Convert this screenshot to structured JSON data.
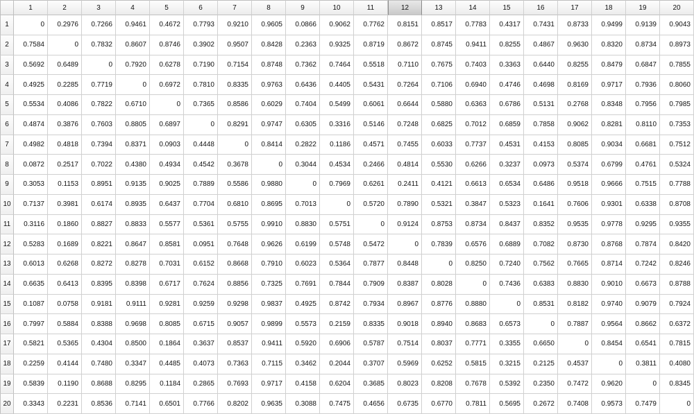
{
  "selected_column": 12,
  "column_headers": [
    "1",
    "2",
    "3",
    "4",
    "5",
    "6",
    "7",
    "8",
    "9",
    "10",
    "11",
    "12",
    "13",
    "14",
    "15",
    "16",
    "17",
    "18",
    "19",
    "20"
  ],
  "row_headers": [
    "1",
    "2",
    "3",
    "4",
    "5",
    "6",
    "7",
    "8",
    "9",
    "10",
    "11",
    "12",
    "13",
    "14",
    "15",
    "16",
    "17",
    "18",
    "19",
    "20"
  ],
  "chart_data": {
    "type": "table",
    "title": "",
    "columns": [
      "1",
      "2",
      "3",
      "4",
      "5",
      "6",
      "7",
      "8",
      "9",
      "10",
      "11",
      "12",
      "13",
      "14",
      "15",
      "16",
      "17",
      "18",
      "19",
      "20"
    ],
    "rows": [
      [
        "0",
        "0.2976",
        "0.7266",
        "0.9461",
        "0.4672",
        "0.7793",
        "0.9210",
        "0.9605",
        "0.0866",
        "0.9062",
        "0.7762",
        "0.8151",
        "0.8517",
        "0.7783",
        "0.4317",
        "0.7431",
        "0.8733",
        "0.9499",
        "0.9139",
        "0.9043"
      ],
      [
        "0.7584",
        "0",
        "0.7832",
        "0.8607",
        "0.8746",
        "0.3902",
        "0.9507",
        "0.8428",
        "0.2363",
        "0.9325",
        "0.8719",
        "0.8672",
        "0.8745",
        "0.9411",
        "0.8255",
        "0.4867",
        "0.9630",
        "0.8320",
        "0.8734",
        "0.8973"
      ],
      [
        "0.5692",
        "0.6489",
        "0",
        "0.7920",
        "0.6278",
        "0.7190",
        "0.7154",
        "0.8748",
        "0.7362",
        "0.7464",
        "0.5518",
        "0.7110",
        "0.7675",
        "0.7403",
        "0.3363",
        "0.6440",
        "0.8255",
        "0.8479",
        "0.6847",
        "0.7855"
      ],
      [
        "0.4925",
        "0.2285",
        "0.7719",
        "0",
        "0.6972",
        "0.7810",
        "0.8335",
        "0.9763",
        "0.6436",
        "0.4405",
        "0.5431",
        "0.7264",
        "0.7106",
        "0.6940",
        "0.4746",
        "0.4698",
        "0.8169",
        "0.9717",
        "0.7936",
        "0.8060"
      ],
      [
        "0.5534",
        "0.4086",
        "0.7822",
        "0.6710",
        "0",
        "0.7365",
        "0.8586",
        "0.6029",
        "0.7404",
        "0.5499",
        "0.6061",
        "0.6644",
        "0.5880",
        "0.6363",
        "0.6786",
        "0.5131",
        "0.2768",
        "0.8348",
        "0.7956",
        "0.7985"
      ],
      [
        "0.4874",
        "0.3876",
        "0.7603",
        "0.8805",
        "0.6897",
        "0",
        "0.8291",
        "0.9747",
        "0.6305",
        "0.3316",
        "0.5146",
        "0.7248",
        "0.6825",
        "0.7012",
        "0.6859",
        "0.7858",
        "0.9062",
        "0.8281",
        "0.8110",
        "0.7353"
      ],
      [
        "0.4982",
        "0.4818",
        "0.7394",
        "0.8371",
        "0.0903",
        "0.4448",
        "0",
        "0.8414",
        "0.2822",
        "0.1186",
        "0.4571",
        "0.7455",
        "0.6033",
        "0.7737",
        "0.4531",
        "0.4153",
        "0.8085",
        "0.9034",
        "0.6681",
        "0.7512"
      ],
      [
        "0.0872",
        "0.2517",
        "0.7022",
        "0.4380",
        "0.4934",
        "0.4542",
        "0.3678",
        "0",
        "0.3044",
        "0.4534",
        "0.2466",
        "0.4814",
        "0.5530",
        "0.6266",
        "0.3237",
        "0.0973",
        "0.5374",
        "0.6799",
        "0.4761",
        "0.5324"
      ],
      [
        "0.3053",
        "0.1153",
        "0.8951",
        "0.9135",
        "0.9025",
        "0.7889",
        "0.5586",
        "0.9880",
        "0",
        "0.7969",
        "0.6261",
        "0.2411",
        "0.4121",
        "0.6613",
        "0.6534",
        "0.6486",
        "0.9518",
        "0.9666",
        "0.7515",
        "0.7788"
      ],
      [
        "0.7137",
        "0.3981",
        "0.6174",
        "0.8935",
        "0.6437",
        "0.7704",
        "0.6810",
        "0.8695",
        "0.7013",
        "0",
        "0.5720",
        "0.7890",
        "0.5321",
        "0.3847",
        "0.5323",
        "0.1641",
        "0.7606",
        "0.9301",
        "0.6338",
        "0.8708"
      ],
      [
        "0.3116",
        "0.1860",
        "0.8827",
        "0.8833",
        "0.5577",
        "0.5361",
        "0.5755",
        "0.9910",
        "0.8830",
        "0.5751",
        "0",
        "0.9124",
        "0.8753",
        "0.8734",
        "0.8437",
        "0.8352",
        "0.9535",
        "0.9778",
        "0.9295",
        "0.9355"
      ],
      [
        "0.5283",
        "0.1689",
        "0.8221",
        "0.8647",
        "0.8581",
        "0.0951",
        "0.7648",
        "0.9626",
        "0.6199",
        "0.5748",
        "0.5472",
        "0",
        "0.7839",
        "0.6576",
        "0.6889",
        "0.7082",
        "0.8730",
        "0.8768",
        "0.7874",
        "0.8420"
      ],
      [
        "0.6013",
        "0.6268",
        "0.8272",
        "0.8278",
        "0.7031",
        "0.6152",
        "0.8668",
        "0.7910",
        "0.6023",
        "0.5364",
        "0.7877",
        "0.8448",
        "0",
        "0.8250",
        "0.7240",
        "0.7562",
        "0.7665",
        "0.8714",
        "0.7242",
        "0.8246"
      ],
      [
        "0.6635",
        "0.6413",
        "0.8395",
        "0.8398",
        "0.6717",
        "0.7624",
        "0.8856",
        "0.7325",
        "0.7691",
        "0.7844",
        "0.7909",
        "0.8387",
        "0.8028",
        "0",
        "0.7436",
        "0.6383",
        "0.8830",
        "0.9010",
        "0.6673",
        "0.8788"
      ],
      [
        "0.1087",
        "0.0758",
        "0.9181",
        "0.9111",
        "0.9281",
        "0.9259",
        "0.9298",
        "0.9837",
        "0.4925",
        "0.8742",
        "0.7934",
        "0.8967",
        "0.8776",
        "0.8880",
        "0",
        "0.8531",
        "0.8182",
        "0.9740",
        "0.9079",
        "0.7924"
      ],
      [
        "0.7997",
        "0.5884",
        "0.8388",
        "0.9698",
        "0.8085",
        "0.6715",
        "0.9057",
        "0.9899",
        "0.5573",
        "0.2159",
        "0.8335",
        "0.9018",
        "0.8940",
        "0.8683",
        "0.6573",
        "0",
        "0.7887",
        "0.9564",
        "0.8662",
        "0.6372"
      ],
      [
        "0.5821",
        "0.5365",
        "0.4304",
        "0.8500",
        "0.1864",
        "0.3637",
        "0.8537",
        "0.9411",
        "0.5920",
        "0.6906",
        "0.5787",
        "0.7514",
        "0.8037",
        "0.7771",
        "0.3355",
        "0.6650",
        "0",
        "0.8454",
        "0.6541",
        "0.7815"
      ],
      [
        "0.2259",
        "0.4144",
        "0.7480",
        "0.3347",
        "0.4485",
        "0.4073",
        "0.7363",
        "0.7115",
        "0.3462",
        "0.2044",
        "0.3707",
        "0.5969",
        "0.6252",
        "0.5815",
        "0.3215",
        "0.2125",
        "0.4537",
        "0",
        "0.3811",
        "0.4080"
      ],
      [
        "0.5839",
        "0.1190",
        "0.8688",
        "0.8295",
        "0.1184",
        "0.2865",
        "0.7693",
        "0.9717",
        "0.4158",
        "0.6204",
        "0.3685",
        "0.8023",
        "0.8208",
        "0.7678",
        "0.5392",
        "0.2350",
        "0.7472",
        "0.9620",
        "0",
        "0.8345"
      ],
      [
        "0.3343",
        "0.2231",
        "0.8536",
        "0.7141",
        "0.6501",
        "0.7766",
        "0.8202",
        "0.9635",
        "0.3088",
        "0.7475",
        "0.4656",
        "0.6735",
        "0.6770",
        "0.7811",
        "0.5695",
        "0.2672",
        "0.7408",
        "0.9573",
        "0.7479",
        "0"
      ]
    ]
  }
}
